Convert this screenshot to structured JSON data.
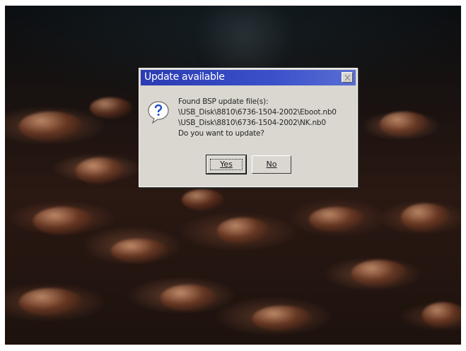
{
  "dialog": {
    "title": "Update available",
    "icon": "question-icon",
    "message_lines": [
      "Found BSP update file(s):",
      "\\USB_Disk\\8810\\6736-1504-2002\\Eboot.nb0",
      "\\USB_Disk\\8810\\6736-1504-2002\\NK.nb0",
      "Do you want to update?"
    ],
    "buttons": {
      "yes_label": "Yes",
      "no_label": "No"
    },
    "close_icon": "close-icon"
  },
  "colors": {
    "titlebar": "#3d52c6",
    "dialog_face": "#d6d3cc"
  }
}
